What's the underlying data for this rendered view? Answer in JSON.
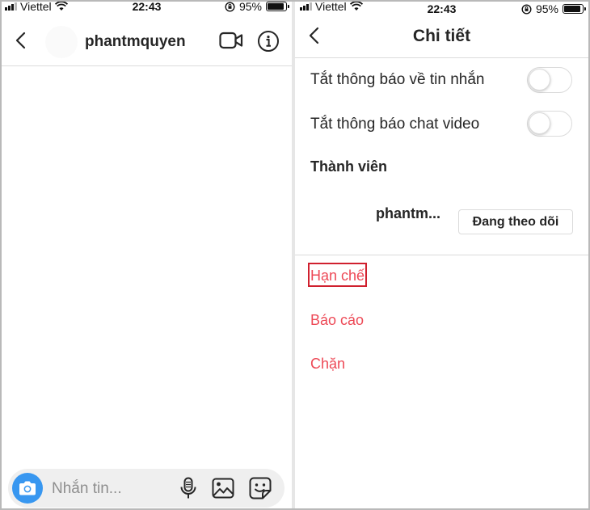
{
  "status_bar": {
    "carrier": "Viettel",
    "time": "22:43",
    "battery": "95%"
  },
  "chat": {
    "username": "phantmquyen",
    "composer_placeholder": "Nhắn tin..."
  },
  "details": {
    "title": "Chi tiết",
    "mute_messages_label": "Tắt thông báo về tin nhắn",
    "mute_messages_on": false,
    "mute_video_label": "Tắt thông báo chat video",
    "mute_video_on": false,
    "members_title": "Thành viên",
    "member_name": "phantm...",
    "following_button": "Đang theo dõi",
    "restrict_label": "Hạn chế",
    "report_label": "Báo cáo",
    "block_label": "Chặn"
  },
  "colors": {
    "danger": "#ed4956",
    "highlight_box": "#d0202e",
    "camera_button": "#3897f0"
  },
  "icons": [
    "back-icon",
    "video-call-icon",
    "info-icon",
    "camera-icon",
    "microphone-icon",
    "image-icon",
    "sticker-icon",
    "wifi-icon",
    "signal-icon",
    "orientation-lock-icon",
    "battery-icon"
  ]
}
